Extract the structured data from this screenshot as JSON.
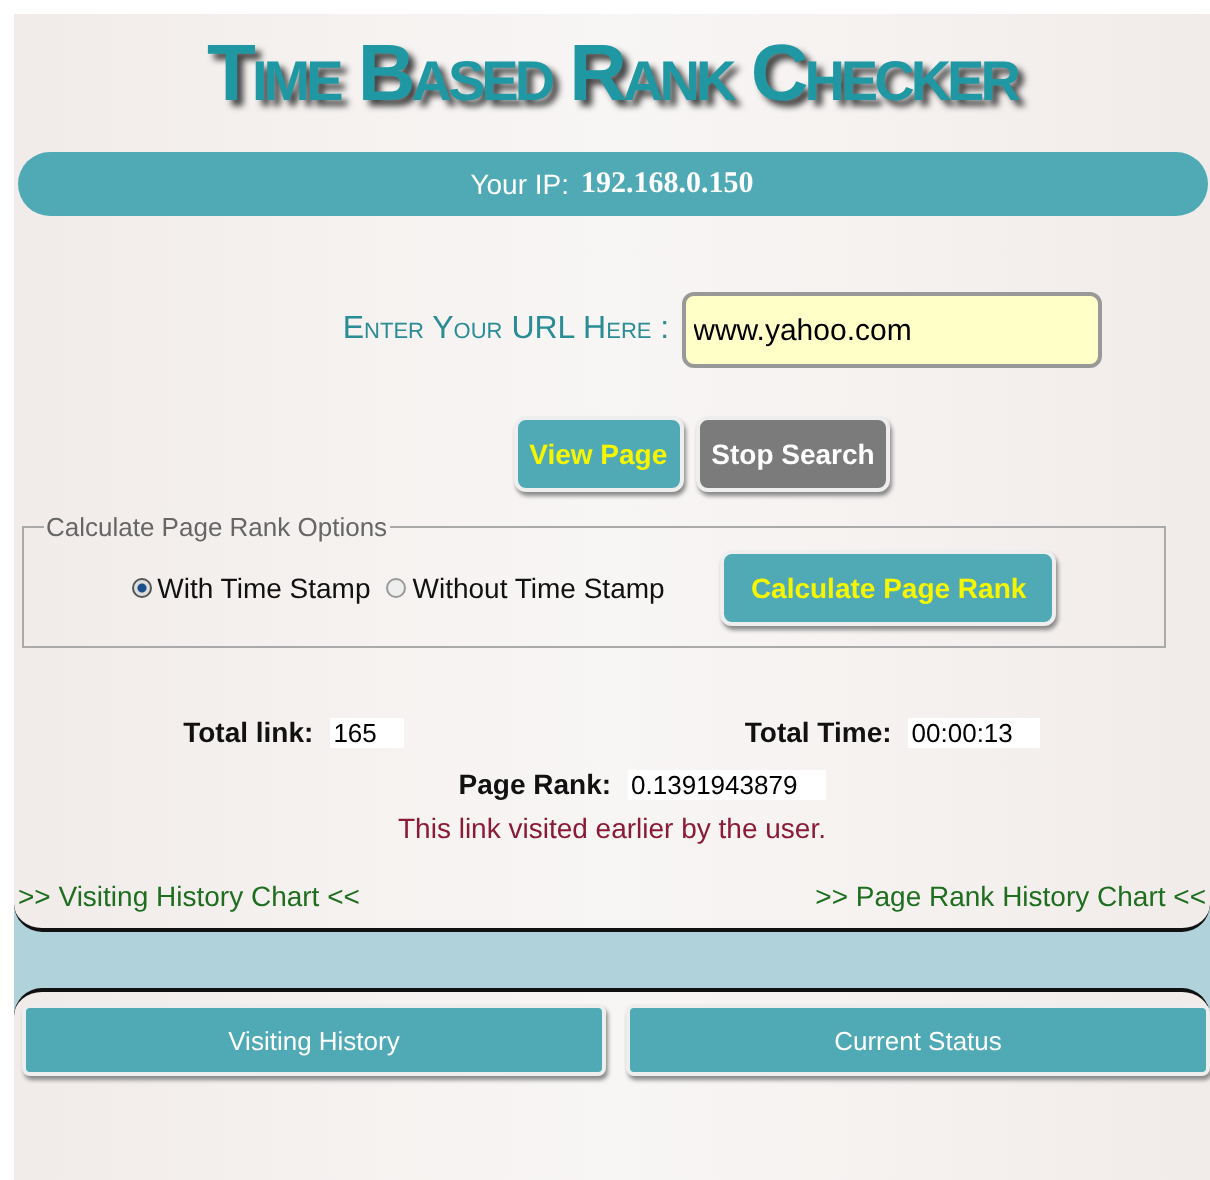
{
  "title": "Time Based Rank Checker",
  "ip_bar": {
    "label": "Your IP:",
    "value": "192.168.0.150"
  },
  "url_field": {
    "label": "Enter Your URL Here :",
    "value": "www.yahoo.com"
  },
  "buttons": [
    {
      "label": "View Page",
      "kind": "primary"
    },
    {
      "label": "Stop Search",
      "kind": "secondary"
    }
  ],
  "options": {
    "legend": "Calculate Page Rank Options",
    "radios": [
      {
        "label": "With Time Stamp",
        "selected": true
      },
      {
        "label": "Without Time Stamp",
        "selected": false
      }
    ],
    "button": "Calculate Page Rank"
  },
  "results": {
    "total_link_label": "Total link:",
    "total_link": "165",
    "total_time_label": "Total Time:",
    "total_time": "00:00:13",
    "page_rank_label": "Page Rank:",
    "page_rank": "0.1391943879",
    "message": "This link visited earlier by the user."
  },
  "chart_links": [
    ">> Visiting History Chart <<",
    ">> Page Rank History Chart <<"
  ],
  "tabs": [
    "Visiting History",
    "Current Status"
  ]
}
